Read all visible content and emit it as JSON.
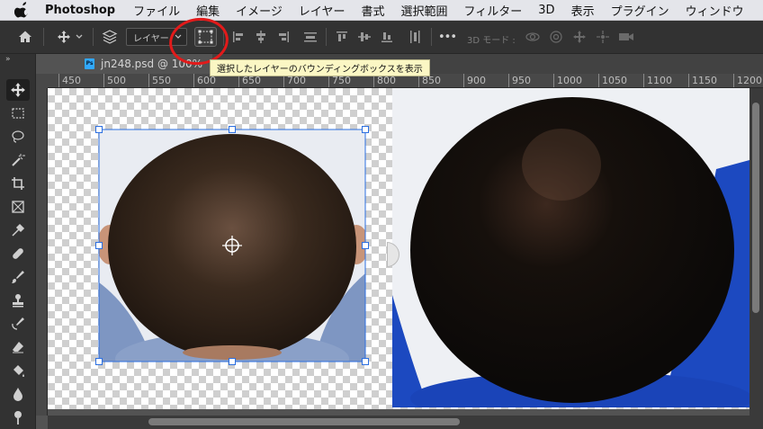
{
  "menubar": {
    "app_name": "Photoshop",
    "items": [
      "ファイル",
      "編集",
      "イメージ",
      "レイヤー",
      "書式",
      "選択範囲",
      "フィルター",
      "3D",
      "表示",
      "プラグイン",
      "ウィンドウ"
    ]
  },
  "options_bar": {
    "auto_select_value": "レイヤー",
    "mode_3d_label": "3D モード :",
    "more_label": "•••"
  },
  "tooltip": {
    "text": "選択したレイヤーのバウンディングボックスを表示"
  },
  "document_tab": {
    "title": "jn248.psd @ 100%"
  },
  "ruler": {
    "ticks": [
      "450",
      "500",
      "550",
      "600",
      "650",
      "700",
      "750",
      "800",
      "850",
      "900",
      "950",
      "1000",
      "1050",
      "1100",
      "1150",
      "1200"
    ]
  },
  "icons": [
    "apple-icon",
    "home-icon",
    "move-icon",
    "layers-icon",
    "bounding-box-icon",
    "align-icon",
    "more-icon",
    "orbit-3d-icon",
    "roll-3d-icon",
    "pan-3d-icon",
    "slide-3d-icon",
    "camera-3d-icon"
  ],
  "colors": {
    "highlight_circle": "#e21a1a",
    "selection_handle": "#2c6fe0",
    "tooltip_bg": "#fbf7c4"
  }
}
